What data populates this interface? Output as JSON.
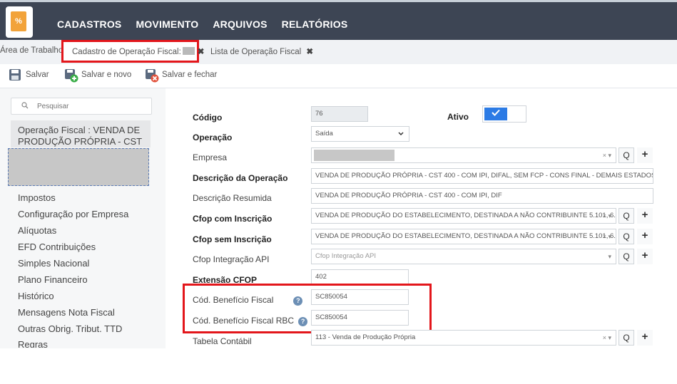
{
  "topbar": {
    "logo_text": "%",
    "menu": [
      "CADASTROS",
      "MOVIMENTO",
      "ARQUIVOS",
      "RELATÓRIOS"
    ]
  },
  "tabs": {
    "home": "Área de Trabalho",
    "active": "Cadastro de Operação Fiscal:",
    "list": "Lista de Operação Fiscal",
    "close_glyph": "✖"
  },
  "toolbar": {
    "save": "Salvar",
    "save_new": "Salvar e novo",
    "save_close": "Salvar e fechar"
  },
  "sidebar": {
    "search_placeholder": "Pesquisar",
    "selected": "Operação Fiscal : VENDA DE PRODUÇÃO PRÓPRIA - CST",
    "items": [
      "Impostos",
      "Configuração por Empresa",
      "Alíquotas",
      "EFD Contribuições",
      "Simples Nacional",
      "Plano Financeiro",
      "Histórico",
      "Mensagens Nota Fiscal",
      "Outras Obrig. Tribut. TTD",
      "Regras"
    ]
  },
  "form": {
    "codigo_label": "Código",
    "codigo_value": "76",
    "ativo_label": "Ativo",
    "ativo_on": true,
    "operacao_label": "Operação",
    "operacao_value": "Saída",
    "empresa_label": "Empresa",
    "descricao_label": "Descrição da Operação",
    "descricao_value": "VENDA DE PRODUÇÃO PRÓPRIA - CST 400 - COM IPI, DIFAL, SEM FCP - CONS FINAL -  DEMAIS ESTADOS",
    "resumida_label": "Descrição Resumida",
    "resumida_value": "VENDA DE PRODUÇÃO PRÓPRIA - CST 400 - COM IPI, DIF",
    "cfop_com_label": "Cfop com Inscrição",
    "cfop_com_value": "VENDA DE PRODUÇÃO DO ESTABELECIMENTO, DESTINADA A NÃO CONTRIBUINTE 5.101, 6....",
    "cfop_sem_label": "Cfop sem Inscrição",
    "cfop_sem_value": "VENDA DE PRODUÇÃO DO ESTABELECIMENTO, DESTINADA A NÃO CONTRIBUINTE 5.101, 6....",
    "cfop_api_label": "Cfop Integração API",
    "cfop_api_placeholder": "Cfop Integração API",
    "extensao_label": "Extensão CFOP",
    "extensao_value": "402",
    "beneficio_label": "Cód. Benefício Fiscal",
    "beneficio_value": "SC850054",
    "beneficio_rbc_label": "Cód. Benefício Fiscal RBC",
    "beneficio_rbc_value": "SC850054",
    "tabela_label": "Tabela Contábil",
    "tabela_value": "113 - Venda de Produção Própria",
    "clear_glyph": "× ▾",
    "dropdown_glyph": "▾",
    "search_glyph": "Q",
    "plus_glyph": "+",
    "help_glyph": "?"
  },
  "colors": {
    "topbar": "#3d4554",
    "highlight": "#e3161b",
    "toggle": "#2c7be5"
  }
}
